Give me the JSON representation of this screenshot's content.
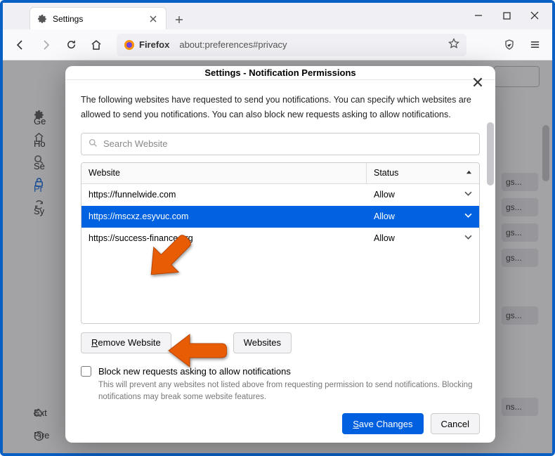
{
  "tab": {
    "title": "Settings"
  },
  "urlbar": {
    "brand": "Firefox",
    "address": "about:preferences#privacy"
  },
  "sidebar": {
    "items": [
      "Ge",
      "Ho",
      "Se",
      "Pr",
      "Sy"
    ],
    "bottom": [
      "Ext",
      "Fire"
    ]
  },
  "bg_buttons": [
    "gs...",
    "gs...",
    "gs...",
    "gs...",
    "gs...",
    "ns..."
  ],
  "dialog": {
    "title": "Settings - Notification Permissions",
    "intro": "The following websites have requested to send you notifications. You can specify which websites are allowed to send you notifications. You can also block new requests asking to allow notifications.",
    "search_placeholder": "Search Website",
    "columns": {
      "website": "Website",
      "status": "Status"
    },
    "rows": [
      {
        "site": "https://funnelwide.com",
        "status": "Allow",
        "selected": false
      },
      {
        "site": "https://mscxz.esyvuc.com",
        "status": "Allow",
        "selected": true
      },
      {
        "site": "https://success-finance.org",
        "status": "Allow",
        "selected": false
      }
    ],
    "remove_btn": "Remove Website",
    "remove_all_btn": "Websites",
    "block_label": "Block new requests asking to allow notifications",
    "block_help": "This will prevent any websites not listed above from requesting permission to send notifications. Blocking notifications may break some website features.",
    "save": "Save Changes",
    "cancel": "Cancel"
  }
}
